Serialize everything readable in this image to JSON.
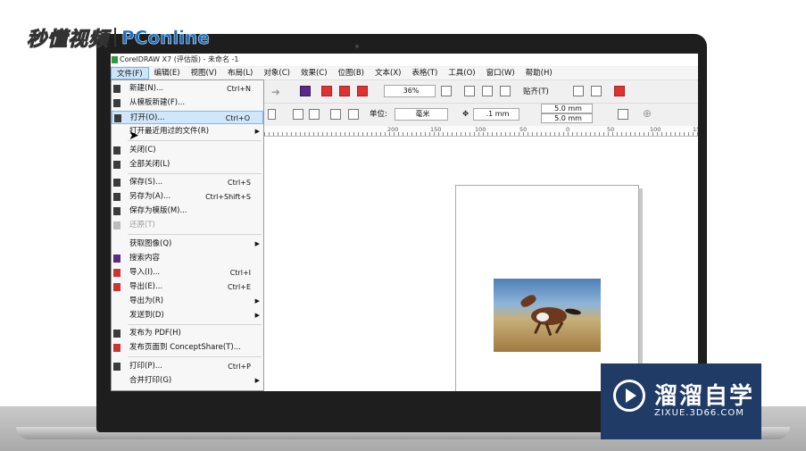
{
  "watermark": {
    "brand_a": "秒懂视频",
    "brand_b": "PConline",
    "badge_title": "溜溜自学",
    "badge_url": "ZIXUE.3D66.COM"
  },
  "window": {
    "title": "CorelDRAW X7 (评估版) - 未命名 -1"
  },
  "menubar": {
    "items": [
      "文件(F)",
      "编辑(E)",
      "视图(V)",
      "布局(L)",
      "对象(C)",
      "效果(C)",
      "位图(B)",
      "文本(X)",
      "表格(T)",
      "工具(O)",
      "窗口(W)",
      "帮助(H)"
    ]
  },
  "toolbar": {
    "zoom": "36%",
    "snap_label": "贴齐(T)",
    "unit_label": "单位:",
    "unit_value": "毫米",
    "nudge_value": ".1 mm",
    "dup_x": "5.0 mm",
    "dup_y": "5.0 mm"
  },
  "ruler": {
    "labels": [
      "200",
      "150",
      "100",
      "50",
      "0",
      "50",
      "100",
      "150",
      "200",
      "250"
    ]
  },
  "file_menu": {
    "items": [
      {
        "label": "新建(N)...",
        "shortcut": "Ctrl+N"
      },
      {
        "label": "从模板新建(F)...",
        "shortcut": ""
      },
      {
        "label": "打开(O)...",
        "shortcut": "Ctrl+O"
      },
      {
        "label": "打开最近用过的文件(R)",
        "shortcut": ""
      },
      {
        "label": "关闭(C)",
        "shortcut": ""
      },
      {
        "label": "全部关闭(L)",
        "shortcut": ""
      },
      {
        "label": "保存(S)...",
        "shortcut": "Ctrl+S"
      },
      {
        "label": "另存为(A)...",
        "shortcut": "Ctrl+Shift+S"
      },
      {
        "label": "保存为模版(M)...",
        "shortcut": ""
      },
      {
        "label": "还原(T)",
        "shortcut": ""
      },
      {
        "label": "获取图像(Q)",
        "shortcut": ""
      },
      {
        "label": "搜索内容",
        "shortcut": ""
      },
      {
        "label": "导入(I)...",
        "shortcut": "Ctrl+I"
      },
      {
        "label": "导出(E)...",
        "shortcut": "Ctrl+E"
      },
      {
        "label": "导出为(R)",
        "shortcut": ""
      },
      {
        "label": "发送到(D)",
        "shortcut": ""
      },
      {
        "label": "发布为 PDF(H)",
        "shortcut": ""
      },
      {
        "label": "发布页面到 ConceptShare(T)...",
        "shortcut": ""
      },
      {
        "label": "打印(P)...",
        "shortcut": "Ctrl+P"
      },
      {
        "label": "合并打印(G)",
        "shortcut": ""
      }
    ]
  }
}
